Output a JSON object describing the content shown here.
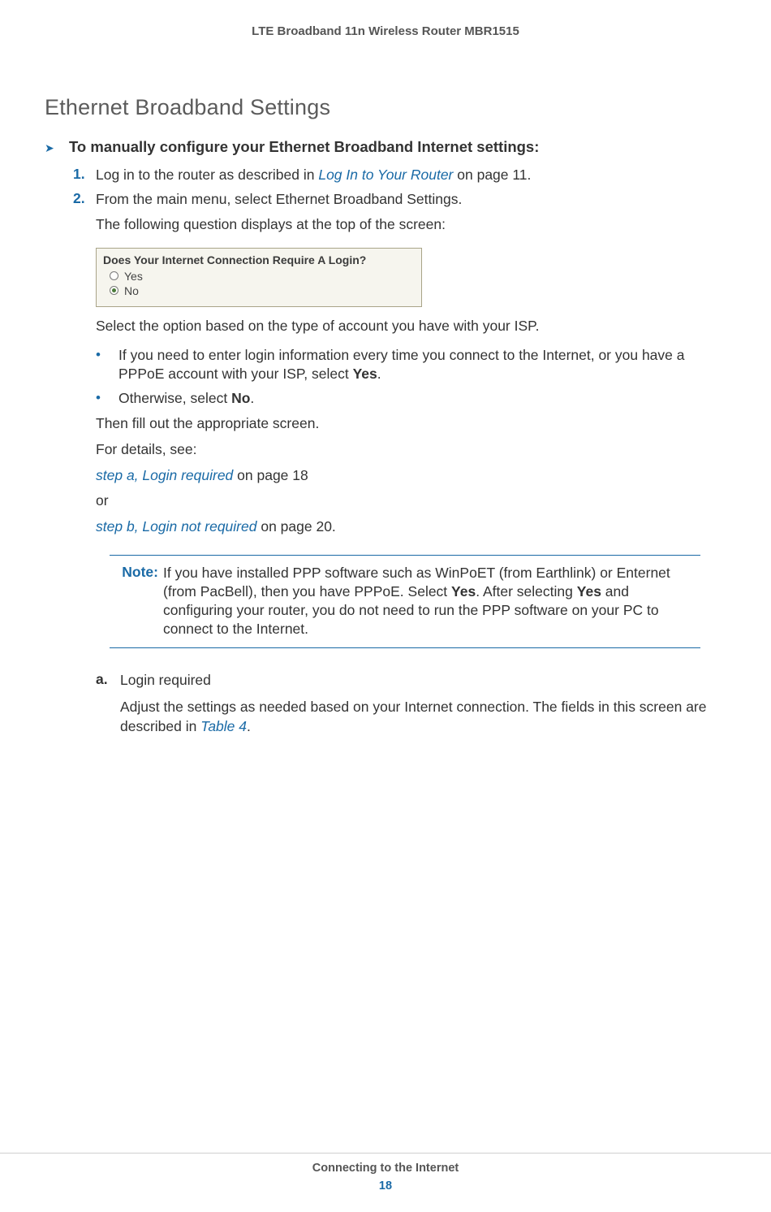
{
  "header": {
    "title": "LTE Broadband 11n Wireless Router MBR1515"
  },
  "section": {
    "heading": "Ethernet Broadband Settings"
  },
  "procedure": {
    "title": "To manually configure your Ethernet Broadband Internet settings:",
    "steps": {
      "0": {
        "num": "1.",
        "text_pre": "Log in to the router as described in ",
        "link": "Log In to Your Router",
        "text_post": " on page 11."
      },
      "1": {
        "num": "2.",
        "text": "From the main menu, select Ethernet Broadband Settings."
      }
    },
    "sub0": "The following question displays at the top of the screen:",
    "sub1": "Select the option based on the type of account you have with your ISP.",
    "bullets": {
      "0": {
        "text_pre": "If you need to enter login information every time you connect to the Internet, or you have a PPPoE account with your ISP, select ",
        "bold": "Yes",
        "text_post": "."
      },
      "1": {
        "text_pre": "Otherwise, select ",
        "bold": "No",
        "text_post": "."
      }
    },
    "sub2": "Then fill out the appropriate screen.",
    "sub3": "For details, see:",
    "ref0": {
      "link": "step a, Login required",
      "post": " on page 18"
    },
    "or": "or",
    "ref1": {
      "link": "step b, Login not required",
      "post": " on page 20."
    }
  },
  "screenshot": {
    "title": "Does Your Internet Connection Require A Login?",
    "option_yes": "Yes",
    "option_no": "No"
  },
  "note": {
    "label": "Note:",
    "body_pre": "If you have installed PPP software such as WinPoET (from Earthlink) or Enternet (from PacBell), then you have PPPoE. Select ",
    "bold1": "Yes",
    "body_mid": ". After selecting ",
    "bold2": "Yes",
    "body_post": " and configuring your router, you do not need to run the PPP software on your PC to connect to the Internet."
  },
  "lettered": {
    "a": {
      "mark": "a.",
      "title": "Login required",
      "sub_pre": "Adjust the settings as needed based on your Internet connection. The fields in this screen are described in ",
      "link": "Table 4",
      "sub_post": "."
    }
  },
  "footer": {
    "chapter": "Connecting to the Internet",
    "page": "18"
  }
}
